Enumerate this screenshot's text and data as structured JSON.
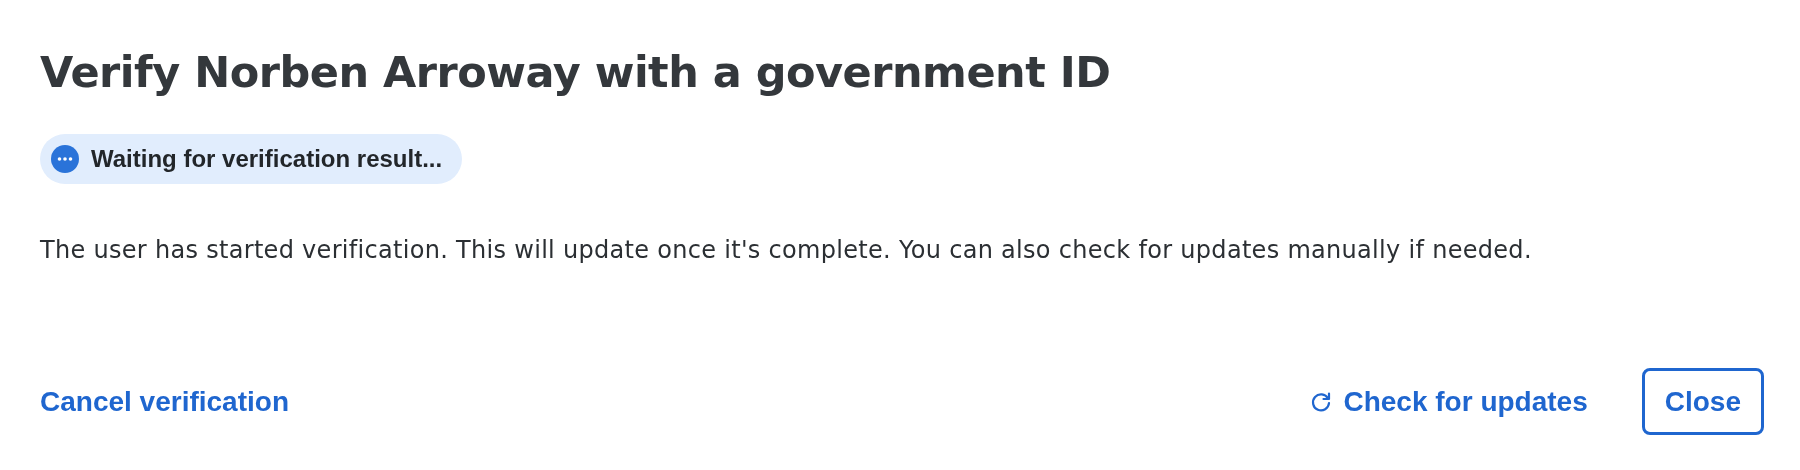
{
  "title": "Verify Norben Arroway with a government ID",
  "status_badge": {
    "label": "Waiting for verification result...",
    "kind": "pending"
  },
  "message": "The user has started verification. This will update once it's complete. You can also check for updates manually if needed.",
  "footer": {
    "cancel_link": "Cancel verification",
    "refresh_link": "Check for updates",
    "close_button": "Close"
  }
}
